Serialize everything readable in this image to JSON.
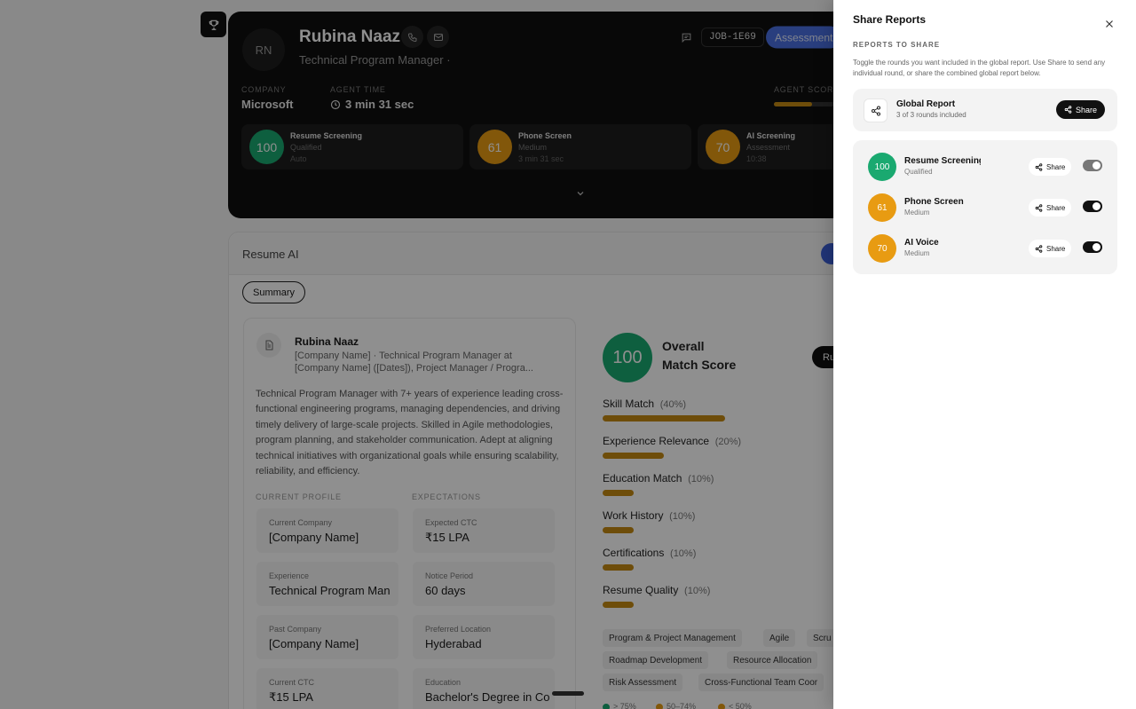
{
  "colors": {
    "score_green": "#1aa970",
    "score_amber": "#e89b12",
    "bar_amber": "#c48a12",
    "accent_blue": "#4a6fe0"
  },
  "candidate": {
    "initials": "RN",
    "name": "Rubina Naaz",
    "title": "Technical Program Manager ·",
    "job_id": "JOB-1E69",
    "status_pill": "Assessment",
    "company_label": "COMPANY",
    "company_value": "Microsoft",
    "agent_time_label": "AGENT TIME",
    "agent_time_value": "3 min 31 sec",
    "agent_score_label": "AGENT SCORE",
    "agent_score_fraction": 0.62,
    "rounds": [
      {
        "score": "100",
        "name": "Resume Screening",
        "sub1": "Qualified",
        "sub2": "Auto",
        "color": "#1aa970"
      },
      {
        "score": "61",
        "name": "Phone Screen",
        "sub1": "Medium",
        "sub2": "3 min 31 sec",
        "color": "#e89b12"
      },
      {
        "score": "70",
        "name": "AI Screening",
        "sub1": "Assessment",
        "sub2": "10:38",
        "color": "#e89b12"
      }
    ]
  },
  "resume": {
    "section_title": "Resume AI",
    "tab_summary": "Summary",
    "profile_name": "Rubina Naaz",
    "profile_sub": "[Company Name] · Technical Program Manager at [Company Name] ([Dates]), Project Manager / Progra...",
    "summary": "Technical Program Manager with 7+ years of experience leading cross-functional engineering programs, managing dependencies, and driving timely delivery of large-scale projects. Skilled in Agile methodologies, program planning, and stakeholder communication. Adept at aligning technical initiatives with organizational goals while ensuring scalability, reliability, and efficiency.",
    "current_profile_label": "CURRENT PROFILE",
    "expectations_label": "EXPECTATIONS",
    "current_profile": [
      {
        "label": "Current Company",
        "value": "[Company Name]"
      },
      {
        "label": "Experience",
        "value": "Technical Program Man"
      },
      {
        "label": "Past Company",
        "value": "[Company Name]"
      },
      {
        "label": "Current CTC",
        "value": "₹15 LPA"
      }
    ],
    "expectations": [
      {
        "label": "Expected CTC",
        "value": "₹15 LPA"
      },
      {
        "label": "Notice Period",
        "value": "60 days"
      },
      {
        "label": "Preferred Location",
        "value": "Hyderabad"
      },
      {
        "label": "Education",
        "value": "Bachelor's Degree in Co"
      }
    ],
    "overall_score": "100",
    "overall_title_line1": "Overall",
    "overall_title_line2": "Match Score",
    "run_button": "Ru",
    "metrics": [
      {
        "label": "Skill Match",
        "weight": "(40%)",
        "fill": 0.4
      },
      {
        "label": "Experience Relevance",
        "weight": "(20%)",
        "fill": 0.2
      },
      {
        "label": "Education Match",
        "weight": "(10%)",
        "fill": 0.1
      },
      {
        "label": "Work History",
        "weight": "(10%)",
        "fill": 0.1
      },
      {
        "label": "Certifications",
        "weight": "(10%)",
        "fill": 0.1
      },
      {
        "label": "Resume Quality",
        "weight": "(10%)",
        "fill": 0.1
      }
    ],
    "skills": [
      "Program & Project Management",
      "Agile",
      "Scru",
      "Roadmap Development",
      "Resource Allocation",
      "Risk Assessment",
      "Cross-Functional Team Coor"
    ],
    "legend": [
      {
        "text": "> 75%",
        "color": "#1aa970"
      },
      {
        "text": "50–74%",
        "color": "#e89b12"
      },
      {
        "text": "< 50%",
        "color": "#e89b12"
      }
    ]
  },
  "share_panel": {
    "title": "Share Reports",
    "close_icon": "close-icon",
    "section_label": "REPORTS TO SHARE",
    "description": "Toggle the rounds you want included in the global report. Use Share to send any individual round, or share the combined global report below.",
    "global": {
      "name": "Global Report",
      "sub": "3 of 3 rounds included",
      "share_label": "Share"
    },
    "rounds": [
      {
        "score": "100",
        "name": "Resume Screening",
        "sub": "Qualified",
        "share_label": "Share",
        "enabled": true,
        "color": "#1aa970"
      },
      {
        "score": "61",
        "name": "Phone Screen",
        "sub": "Medium",
        "share_label": "Share",
        "enabled": true,
        "color": "#e89b12"
      },
      {
        "score": "70",
        "name": "AI Voice",
        "sub": "Medium",
        "share_label": "Share",
        "enabled": true,
        "color": "#e89b12"
      }
    ]
  }
}
